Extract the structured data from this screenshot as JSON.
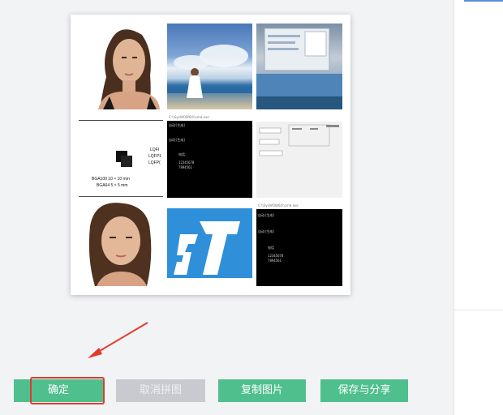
{
  "collage": {
    "tiles": [
      {
        "name": "portrait-photo"
      },
      {
        "name": "beach-photo"
      },
      {
        "name": "desktop-screenshot"
      },
      {
        "name": "chip-package-diagram",
        "labels": [
          "BGA100 10 × 10 mm",
          "BGA64 5 × 5 mm",
          "LQFI",
          "LQFP1",
          "LQFP("
        ]
      },
      {
        "name": "console-window",
        "caption": "C:\\\\SysWOW64\\\\cmd.exe",
        "lines": [
          "",
          "自动(生成)",
          "",
          "自动(生成)",
          "",
          "     电话",
          "     12345678",
          "     7894561"
        ]
      },
      {
        "name": "form-screenshot"
      },
      {
        "name": "portrait-photo-2"
      },
      {
        "name": "st-logo"
      },
      {
        "name": "console-window-2",
        "caption": "C:\\\\SysWOW64\\\\cmd.exe",
        "lines": [
          "",
          "自动(生成)",
          "",
          "自动(生成)",
          "",
          "     电话",
          "     12345678",
          "     7894561"
        ]
      }
    ]
  },
  "actions": {
    "confirm": "确定",
    "cancel_collage": "取消拼图",
    "copy_image": "复制图片",
    "save_share": "保存与分享"
  },
  "colors": {
    "primary": "#4fc08d",
    "disabled": "#c8cacf",
    "annotation": "#e23b2e"
  }
}
